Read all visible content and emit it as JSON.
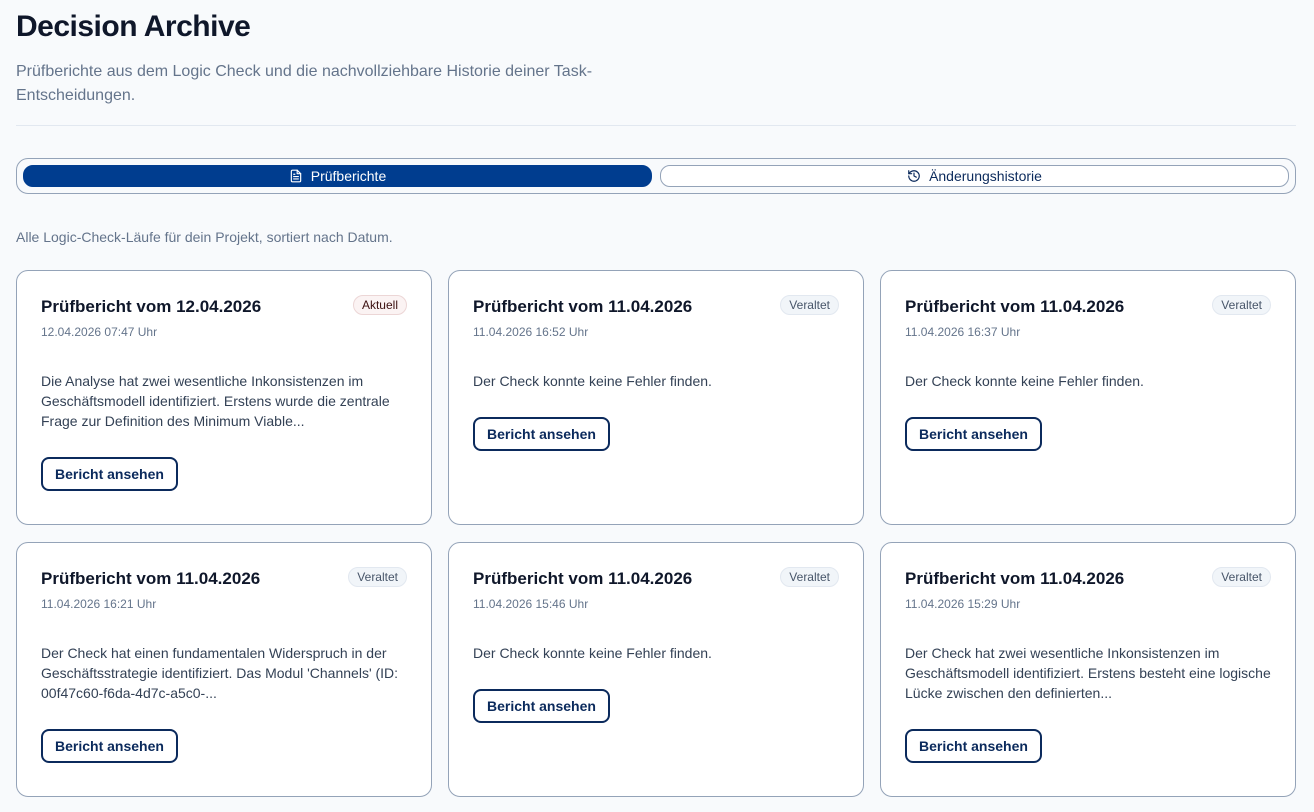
{
  "header": {
    "title": "Decision Archive",
    "subtitle": "Prüfberichte aus dem Logic Check und die nachvollziehbare Historie deiner Task-Entscheidungen."
  },
  "tabs": [
    {
      "label": "Prüfberichte",
      "icon": "document-icon",
      "active": true
    },
    {
      "label": "Änderungshistorie",
      "icon": "history-icon",
      "active": false
    }
  ],
  "list_caption": "Alle Logic-Check-Läufe für dein Projekt, sortiert nach Datum.",
  "cards": [
    {
      "title": "Prüfbericht vom 12.04.2026",
      "badge": "Aktuell",
      "date": "12.04.2026 07:47 Uhr",
      "summary": "Die Analyse hat zwei wesentliche Inkonsistenzen im Geschäftsmodell identifiziert. Erstens wurde die zentrale Frage zur Definition des Minimum Viable...",
      "button": "Bericht ansehen"
    },
    {
      "title": "Prüfbericht vom 11.04.2026",
      "badge": "Veraltet",
      "date": "11.04.2026 16:52 Uhr",
      "summary": "Der Check konnte keine Fehler finden.",
      "button": "Bericht ansehen"
    },
    {
      "title": "Prüfbericht vom 11.04.2026",
      "badge": "Veraltet",
      "date": "11.04.2026 16:37 Uhr",
      "summary": "Der Check konnte keine Fehler finden.",
      "button": "Bericht ansehen"
    },
    {
      "title": "Prüfbericht vom 11.04.2026",
      "badge": "Veraltet",
      "date": "11.04.2026 16:21 Uhr",
      "summary": "Der Check hat einen fundamentalen Widerspruch in der Geschäftsstrategie identifiziert. Das Modul 'Channels' (ID: 00f47c60-f6da-4d7c-a5c0-...",
      "button": "Bericht ansehen"
    },
    {
      "title": "Prüfbericht vom 11.04.2026",
      "badge": "Veraltet",
      "date": "11.04.2026 15:46 Uhr",
      "summary": "Der Check konnte keine Fehler finden.",
      "button": "Bericht ansehen"
    },
    {
      "title": "Prüfbericht vom 11.04.2026",
      "badge": "Veraltet",
      "date": "11.04.2026 15:29 Uhr",
      "summary": "Der Check hat zwei wesentliche Inkonsistenzen im Geschäftsmodell identifiziert. Erstens besteht eine logische Lücke zwischen den definierten...",
      "button": "Bericht ansehen"
    }
  ],
  "colors": {
    "accent": "#003d8f",
    "button_border": "#0b2a5c",
    "background": "#f8fafc"
  }
}
